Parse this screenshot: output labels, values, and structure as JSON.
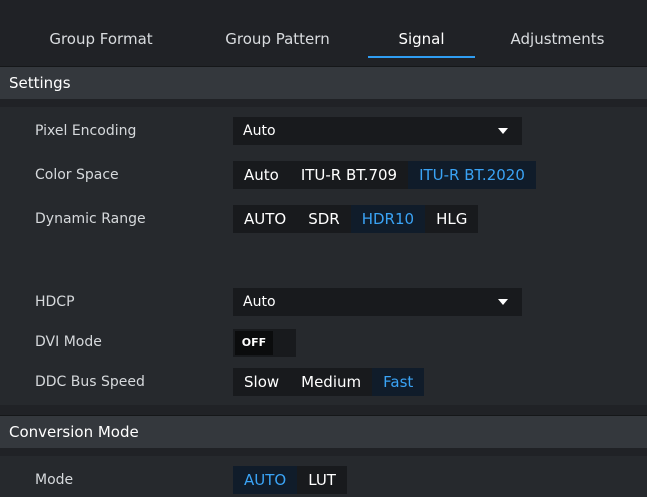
{
  "tabs": [
    {
      "label": "Group Format",
      "active": false
    },
    {
      "label": "Group Pattern",
      "active": false
    },
    {
      "label": "Signal",
      "active": true
    },
    {
      "label": "Adjustments",
      "active": false
    }
  ],
  "settings": {
    "header": "Settings",
    "pixel_encoding": {
      "label": "Pixel Encoding",
      "value": "Auto"
    },
    "color_space": {
      "label": "Color Space",
      "options": [
        "Auto",
        "ITU-R BT.709",
        "ITU-R BT.2020"
      ],
      "selected": "ITU-R BT.2020"
    },
    "dynamic_range": {
      "label": "Dynamic Range",
      "options": [
        "AUTO",
        "SDR",
        "HDR10",
        "HLG"
      ],
      "selected": "HDR10"
    },
    "hdcp": {
      "label": "HDCP",
      "value": "Auto"
    },
    "dvi_mode": {
      "label": "DVI Mode",
      "value": "OFF"
    },
    "ddc_bus_speed": {
      "label": "DDC Bus Speed",
      "options": [
        "Slow",
        "Medium",
        "Fast"
      ],
      "selected": "Fast"
    }
  },
  "conversion": {
    "header": "Conversion Mode",
    "mode": {
      "label": "Mode",
      "options": [
        "AUTO",
        "LUT"
      ],
      "selected": "AUTO"
    }
  },
  "colors": {
    "accent": "#2f9df2",
    "background": "#202226",
    "panel": "#26292d",
    "header": "#34383d"
  }
}
